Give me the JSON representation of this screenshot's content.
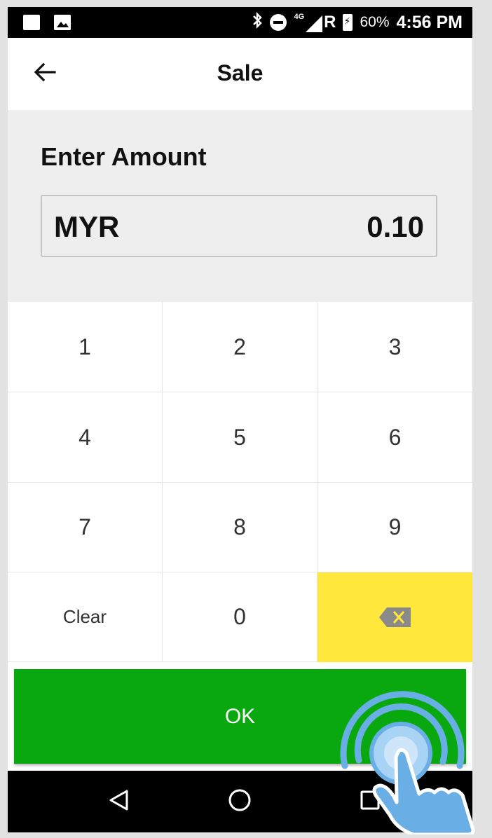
{
  "status_bar": {
    "network": "4G",
    "roaming": "R",
    "battery_percent": "60%",
    "time": "4:56 PM"
  },
  "app_bar": {
    "title": "Sale",
    "back_icon": "arrow-left-icon"
  },
  "amount": {
    "label": "Enter Amount",
    "currency": "MYR",
    "value": "0.10"
  },
  "keypad": {
    "keys": [
      "1",
      "2",
      "3",
      "4",
      "5",
      "6",
      "7",
      "8",
      "9",
      "Clear",
      "0"
    ],
    "backspace_icon": "backspace-icon",
    "backspace_color": "#ffe83b"
  },
  "ok_button": {
    "label": "OK",
    "color": "#0aa80f"
  },
  "nav_bar": {
    "icons": [
      "back-triangle-icon",
      "home-circle-icon",
      "recents-square-icon"
    ]
  },
  "overlay": {
    "icon": "tap-gesture-icon",
    "color": "#6aaee6"
  }
}
